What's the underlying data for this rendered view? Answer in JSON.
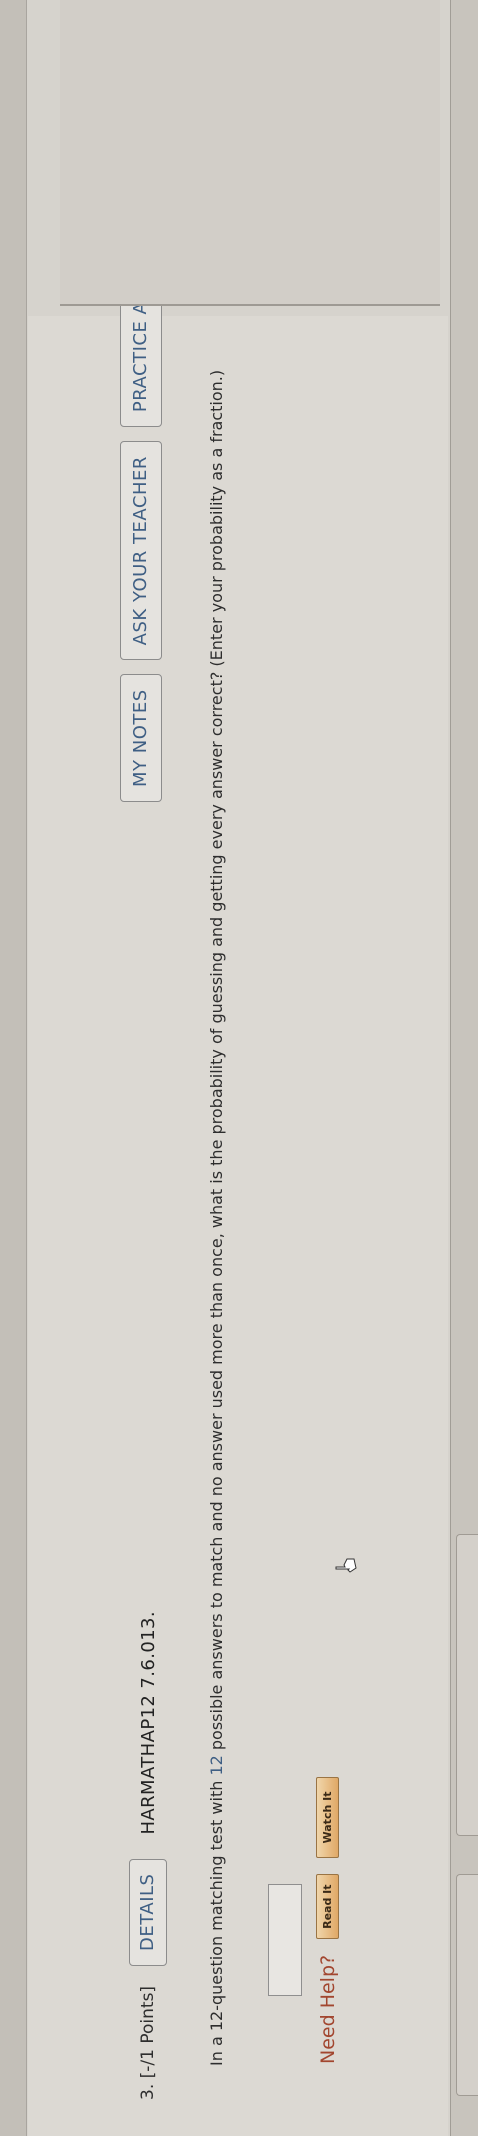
{
  "question": {
    "number": "3.",
    "points": "[-/1 Points]",
    "details_label": "DETAILS",
    "code": "HARMATHAP12 7.6.013.",
    "my_notes_label": "MY NOTES",
    "ask_teacher_label": "ASK YOUR TEACHER",
    "practice_label": "PRACTICE ANOTHER",
    "text_part1": "In a 12-question matching test with ",
    "text_num": "12",
    "text_part2": " possible answers to match and no answer used more than once, what is the probability of guessing and getting every answer correct? (Enter your probability as a fraction.)",
    "answer_value": ""
  },
  "help": {
    "need_help_label": "Need Help?",
    "read_it_label": "Read It",
    "watch_it_label": "Watch It"
  },
  "colors": {
    "link_blue": "#3f5f84",
    "need_help_red": "#a2462f",
    "help_button_orange": "#e0a866"
  },
  "icons": {
    "cursor": "hand-pointer-icon"
  }
}
